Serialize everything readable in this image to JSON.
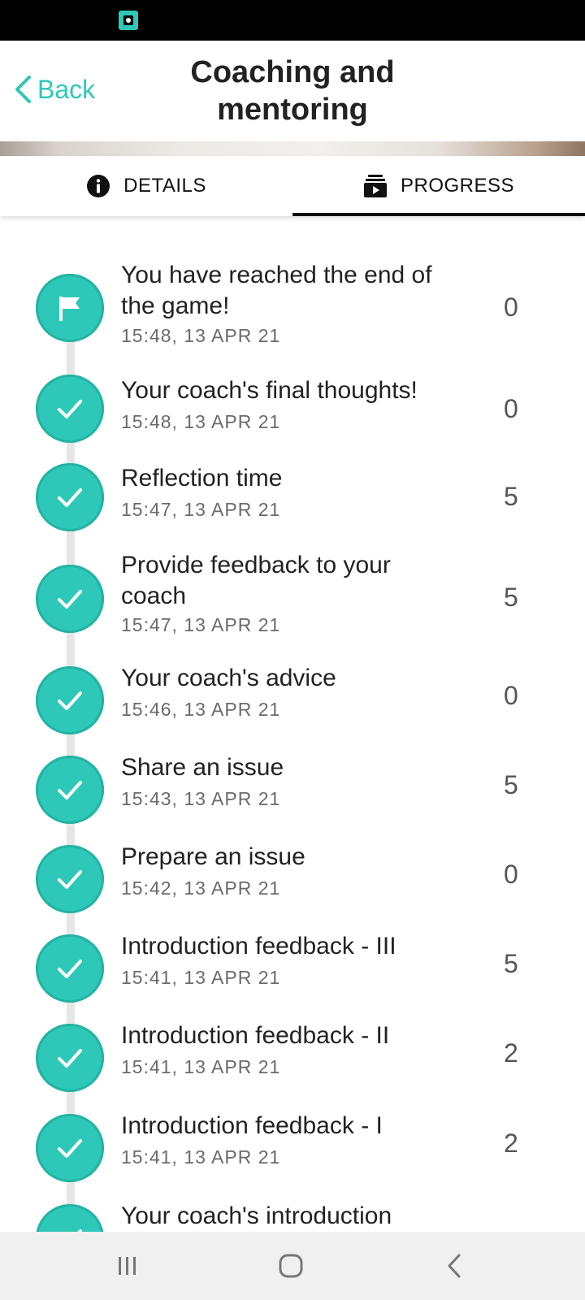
{
  "header": {
    "back_label": "Back",
    "title_line1": "Coaching and",
    "title_line2": "mentoring"
  },
  "tabs": [
    {
      "label": "DETAILS",
      "icon": "info-icon",
      "active": false
    },
    {
      "label": "PROGRESS",
      "icon": "progress-media-icon",
      "active": true
    }
  ],
  "progress": {
    "accent_color": "#2ec8b8",
    "items": [
      {
        "title_line1": "You have reached the end of",
        "title_line2": "the game!",
        "time": "15:48, 13 APR 21",
        "score": "0",
        "icon": "flag-icon"
      },
      {
        "title_line1": "Your coach's final thoughts!",
        "title_line2": "",
        "time": "15:48, 13 APR 21",
        "score": "0",
        "icon": "check-icon"
      },
      {
        "title_line1": "Reflection time",
        "title_line2": "",
        "time": "15:47, 13 APR 21",
        "score": "5",
        "icon": "check-icon"
      },
      {
        "title_line1": "Provide feedback to your",
        "title_line2": "coach",
        "time": "15:47, 13 APR 21",
        "score": "5",
        "icon": "check-icon"
      },
      {
        "title_line1": "Your coach's advice",
        "title_line2": "",
        "time": "15:46, 13 APR 21",
        "score": "0",
        "icon": "check-icon"
      },
      {
        "title_line1": "Share an issue",
        "title_line2": "",
        "time": "15:43, 13 APR 21",
        "score": "5",
        "icon": "check-icon"
      },
      {
        "title_line1": "Prepare an issue",
        "title_line2": "",
        "time": "15:42, 13 APR 21",
        "score": "0",
        "icon": "check-icon"
      },
      {
        "title_line1": "Introduction feedback - III",
        "title_line2": "",
        "time": "15:41, 13 APR 21",
        "score": "5",
        "icon": "check-icon"
      },
      {
        "title_line1": "Introduction feedback - II",
        "title_line2": "",
        "time": "15:41, 13 APR 21",
        "score": "2",
        "icon": "check-icon"
      },
      {
        "title_line1": "Introduction feedback - I",
        "title_line2": "",
        "time": "15:41, 13 APR 21",
        "score": "2",
        "icon": "check-icon"
      },
      {
        "title_line1": "Your coach's introduction",
        "title_line2": "",
        "time": "",
        "score": "",
        "icon": "check-icon"
      }
    ]
  },
  "navbar": {
    "recent_icon": "recent-apps-icon",
    "home_icon": "home-icon",
    "back_icon": "nav-back-icon"
  }
}
